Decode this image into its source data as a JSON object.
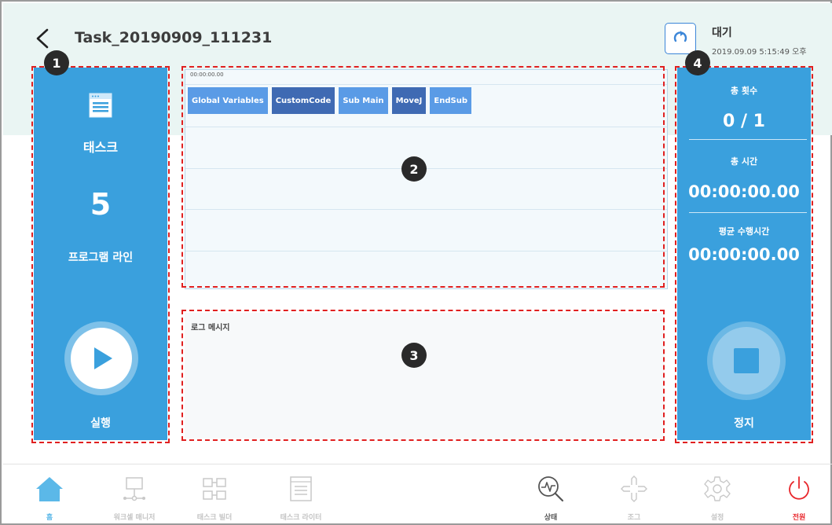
{
  "header": {
    "back_icon": "chevron-left-icon",
    "task_title": "Task_20190909_111231",
    "reset_icon": "reset-icon",
    "status_title": "대기",
    "status_datetime": "2019.09.09 5:15:49 오후"
  },
  "badges": [
    "1",
    "2",
    "3",
    "4"
  ],
  "left_panel": {
    "task_icon": "window-icon",
    "task_label": "태스크",
    "line_count": "5",
    "line_label": "프로그램 라인",
    "run_icon": "play-icon",
    "run_label": "실행"
  },
  "timeline": {
    "time": "00:00:00.00",
    "chips": [
      {
        "label": "Global Variables",
        "color": "#5a9be6"
      },
      {
        "label": "CustomCode",
        "color": "#3f6ab3"
      },
      {
        "label": "Sub Main",
        "color": "#5a9be6"
      },
      {
        "label": "MoveJ",
        "color": "#3f6ab3"
      },
      {
        "label": "EndSub",
        "color": "#5a9be6"
      }
    ]
  },
  "log": {
    "title": "로그 메시지"
  },
  "right_panel": {
    "total_count_label": "총 횟수",
    "total_count_value": "0 / 1",
    "total_time_label": "총 시간",
    "total_time_value": "00:00:00.00",
    "avg_time_label": "평균 수행시간",
    "avg_time_value": "00:00:00.00",
    "stop_icon": "stop-icon",
    "stop_label": "정지"
  },
  "bottom_nav": [
    {
      "label": "홈",
      "icon": "home-icon",
      "color": "#5bb8e8"
    },
    {
      "label": "워크셀 매니저",
      "icon": "workcell-icon",
      "color": "#c4c4c4"
    },
    {
      "label": "태스크 빌더",
      "icon": "task-builder-icon",
      "color": "#c4c4c4"
    },
    {
      "label": "태스크 라이터",
      "icon": "task-writer-icon",
      "color": "#c4c4c4"
    },
    {
      "label": "상태",
      "icon": "status-icon",
      "color": "#555555"
    },
    {
      "label": "조그",
      "icon": "jog-icon",
      "color": "#c4c4c4"
    },
    {
      "label": "설정",
      "icon": "settings-icon",
      "color": "#c4c4c4"
    },
    {
      "label": "전원",
      "icon": "power-icon",
      "color": "#e8262b"
    }
  ],
  "colors": {
    "panel_blue": "#3aa0dd",
    "header_bg": "#eaf5f3",
    "annotation_red": "#e02020"
  }
}
